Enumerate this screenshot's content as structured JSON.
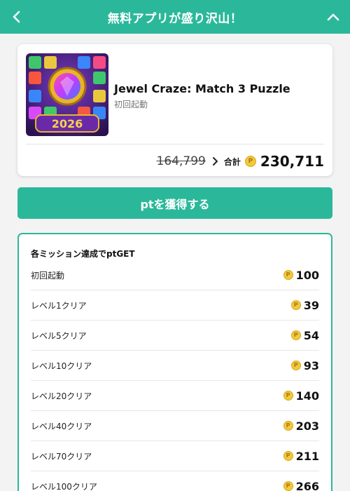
{
  "header": {
    "title": "無料アプリが盛り沢山！"
  },
  "app": {
    "name": "Jewel Craze: Match 3 Puzzle",
    "subtitle": "初回起動",
    "icon_badge_text": "2026",
    "old_points": "164,799",
    "total_label": "合計",
    "total_points": "230,711",
    "coin_glyph": "P"
  },
  "cta": {
    "label": "ptを獲得する"
  },
  "missions": {
    "title": "各ミッション達成でptGET",
    "items": [
      {
        "label": "初回起動",
        "points": "100"
      },
      {
        "label": "レベル1クリア",
        "points": "39"
      },
      {
        "label": "レベル5クリア",
        "points": "54"
      },
      {
        "label": "レベル10クリア",
        "points": "93"
      },
      {
        "label": "レベル20クリア",
        "points": "140"
      },
      {
        "label": "レベル40クリア",
        "points": "203"
      },
      {
        "label": "レベル70クリア",
        "points": "211"
      },
      {
        "label": "レベル100クリア",
        "points": "266"
      }
    ]
  },
  "colors": {
    "brand": "#2bb89a",
    "coin": "#f1c93a"
  },
  "icons": {
    "back": "chevron-left-icon",
    "collapse": "chevron-up-icon",
    "arrow": "chevron-right-icon",
    "coin": "coin-icon"
  }
}
